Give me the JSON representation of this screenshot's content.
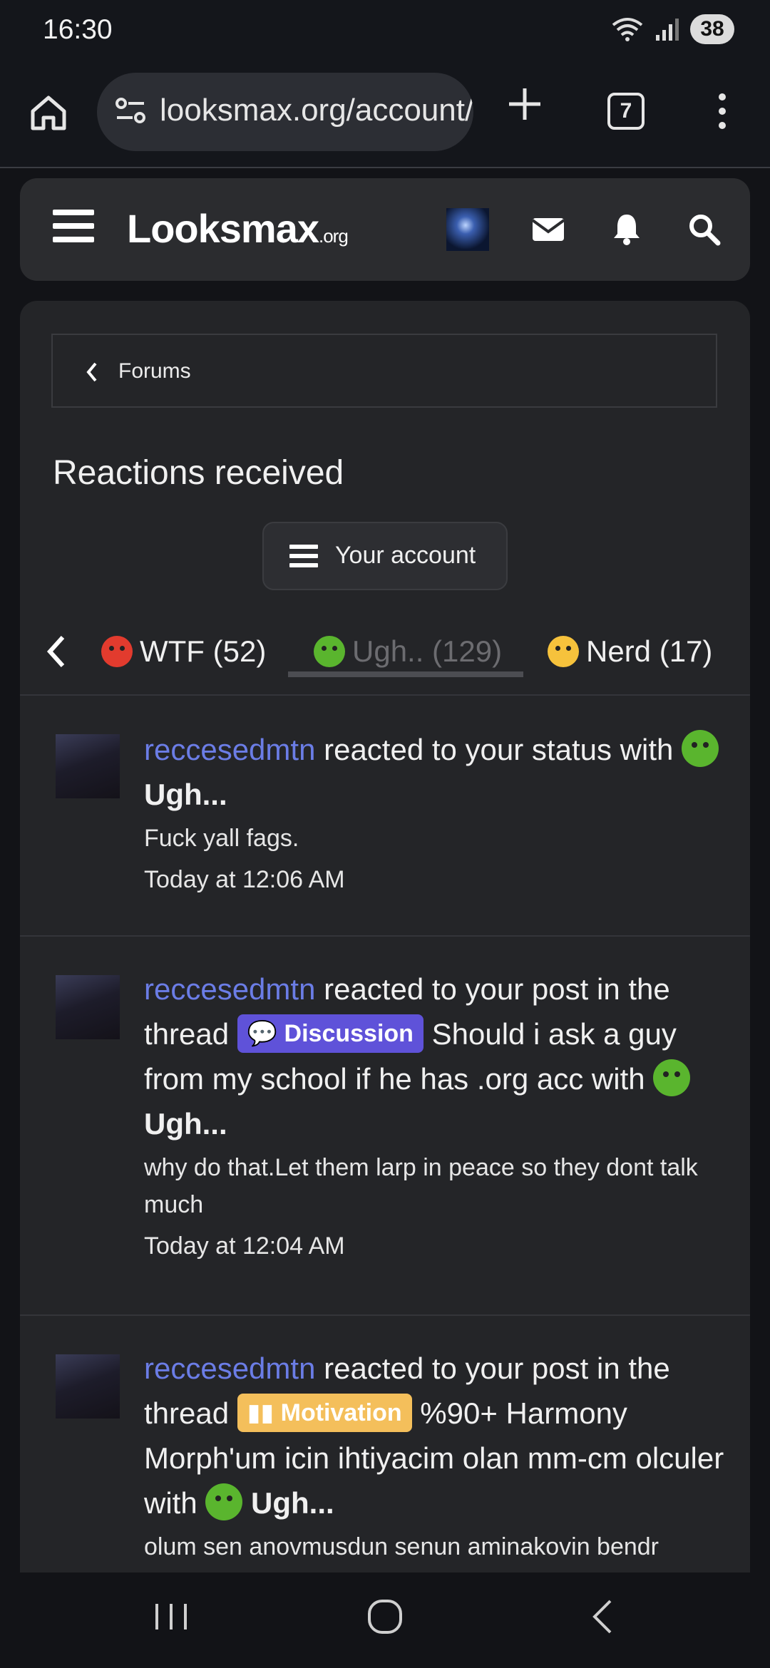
{
  "status_bar": {
    "time": "16:30",
    "battery": "38"
  },
  "browser": {
    "url": "looksmax.org/account/reactions",
    "tab_count": "7"
  },
  "site": {
    "logo_main": "Looksmax",
    "logo_suffix": ".org"
  },
  "breadcrumb": {
    "label": "Forums"
  },
  "page": {
    "title": "Reactions received",
    "account_button": "Your account"
  },
  "tabs": [
    {
      "label": "WTF (52)",
      "emoji": "angry-face",
      "active": false
    },
    {
      "label": "Ugh.. (129)",
      "emoji": "sick-face",
      "active": true
    },
    {
      "label": "Nerd (17)",
      "emoji": "nerd-face",
      "active": false
    }
  ],
  "reactions": [
    {
      "user": "reccesedmtn",
      "action": " reacted to your status with ",
      "reaction": "Ugh...",
      "snippet": "Fuck yall fags.",
      "time": "Today at 12:06 AM"
    },
    {
      "user": "reccesedmtn",
      "action": " reacted to your post in the thread ",
      "prefix": "Discussion",
      "thread": "Should i ask a guy from my school if he has .org acc",
      "with": " with ",
      "reaction": "Ugh...",
      "snippet": "why do that.Let them larp in peace so they dont talk much",
      "time": "Today at 12:04 AM"
    },
    {
      "user": "reccesedmtn",
      "action": " reacted to your post in the thread ",
      "prefix": "Motivation",
      "thread": "%90+ Harmony Morph'um icin ihtiyacim olan mm-cm olculer",
      "with": " with ",
      "reaction": "Ugh...",
      "snippet": "olum sen anovmusdun senun aminakovin bendr"
    }
  ],
  "colors": {
    "username": "#6b7de6",
    "discussion_badge": "#5f52d9",
    "motivation_badge": "#f4bf5b"
  }
}
